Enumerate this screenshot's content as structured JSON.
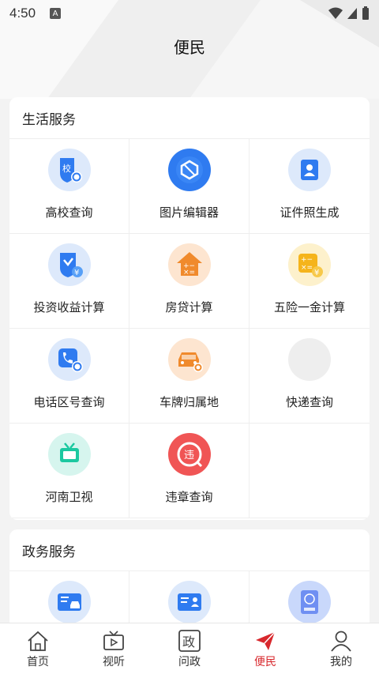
{
  "status": {
    "time": "4:50",
    "badge": "A"
  },
  "page": {
    "title": "便民"
  },
  "life_services": {
    "title": "生活服务",
    "items": [
      {
        "label": "高校查询",
        "icon": "school-search-icon"
      },
      {
        "label": "图片编辑器",
        "icon": "image-editor-icon"
      },
      {
        "label": "证件照生成",
        "icon": "id-photo-icon"
      },
      {
        "label": "投资收益计算",
        "icon": "investment-calc-icon"
      },
      {
        "label": "房贷计算",
        "icon": "mortgage-calc-icon"
      },
      {
        "label": "五险一金计算",
        "icon": "insurance-calc-icon"
      },
      {
        "label": "电话区号查询",
        "icon": "phone-area-code-icon"
      },
      {
        "label": "车牌归属地",
        "icon": "license-plate-icon"
      },
      {
        "label": "快递查询",
        "icon": "express-query-icon"
      },
      {
        "label": "河南卫视",
        "icon": "henan-tv-icon"
      },
      {
        "label": "违章查询",
        "icon": "violation-query-icon"
      },
      {
        "label": "",
        "icon": ""
      }
    ]
  },
  "gov_services": {
    "title": "政务服务",
    "items": [
      {
        "icon": "vehicle-license-icon"
      },
      {
        "icon": "id-card-icon"
      },
      {
        "icon": "passport-icon"
      }
    ]
  },
  "tabs": [
    {
      "label": "首页",
      "icon": "home-icon"
    },
    {
      "label": "视听",
      "icon": "tv-icon"
    },
    {
      "label": "问政",
      "icon": "politics-icon",
      "glyph": "政"
    },
    {
      "label": "便民",
      "icon": "send-icon",
      "active": true
    },
    {
      "label": "我的",
      "icon": "user-icon"
    }
  ],
  "colors": {
    "accent": "#d8282d",
    "blue": "#2f7bf0",
    "orange": "#f08a2c"
  }
}
